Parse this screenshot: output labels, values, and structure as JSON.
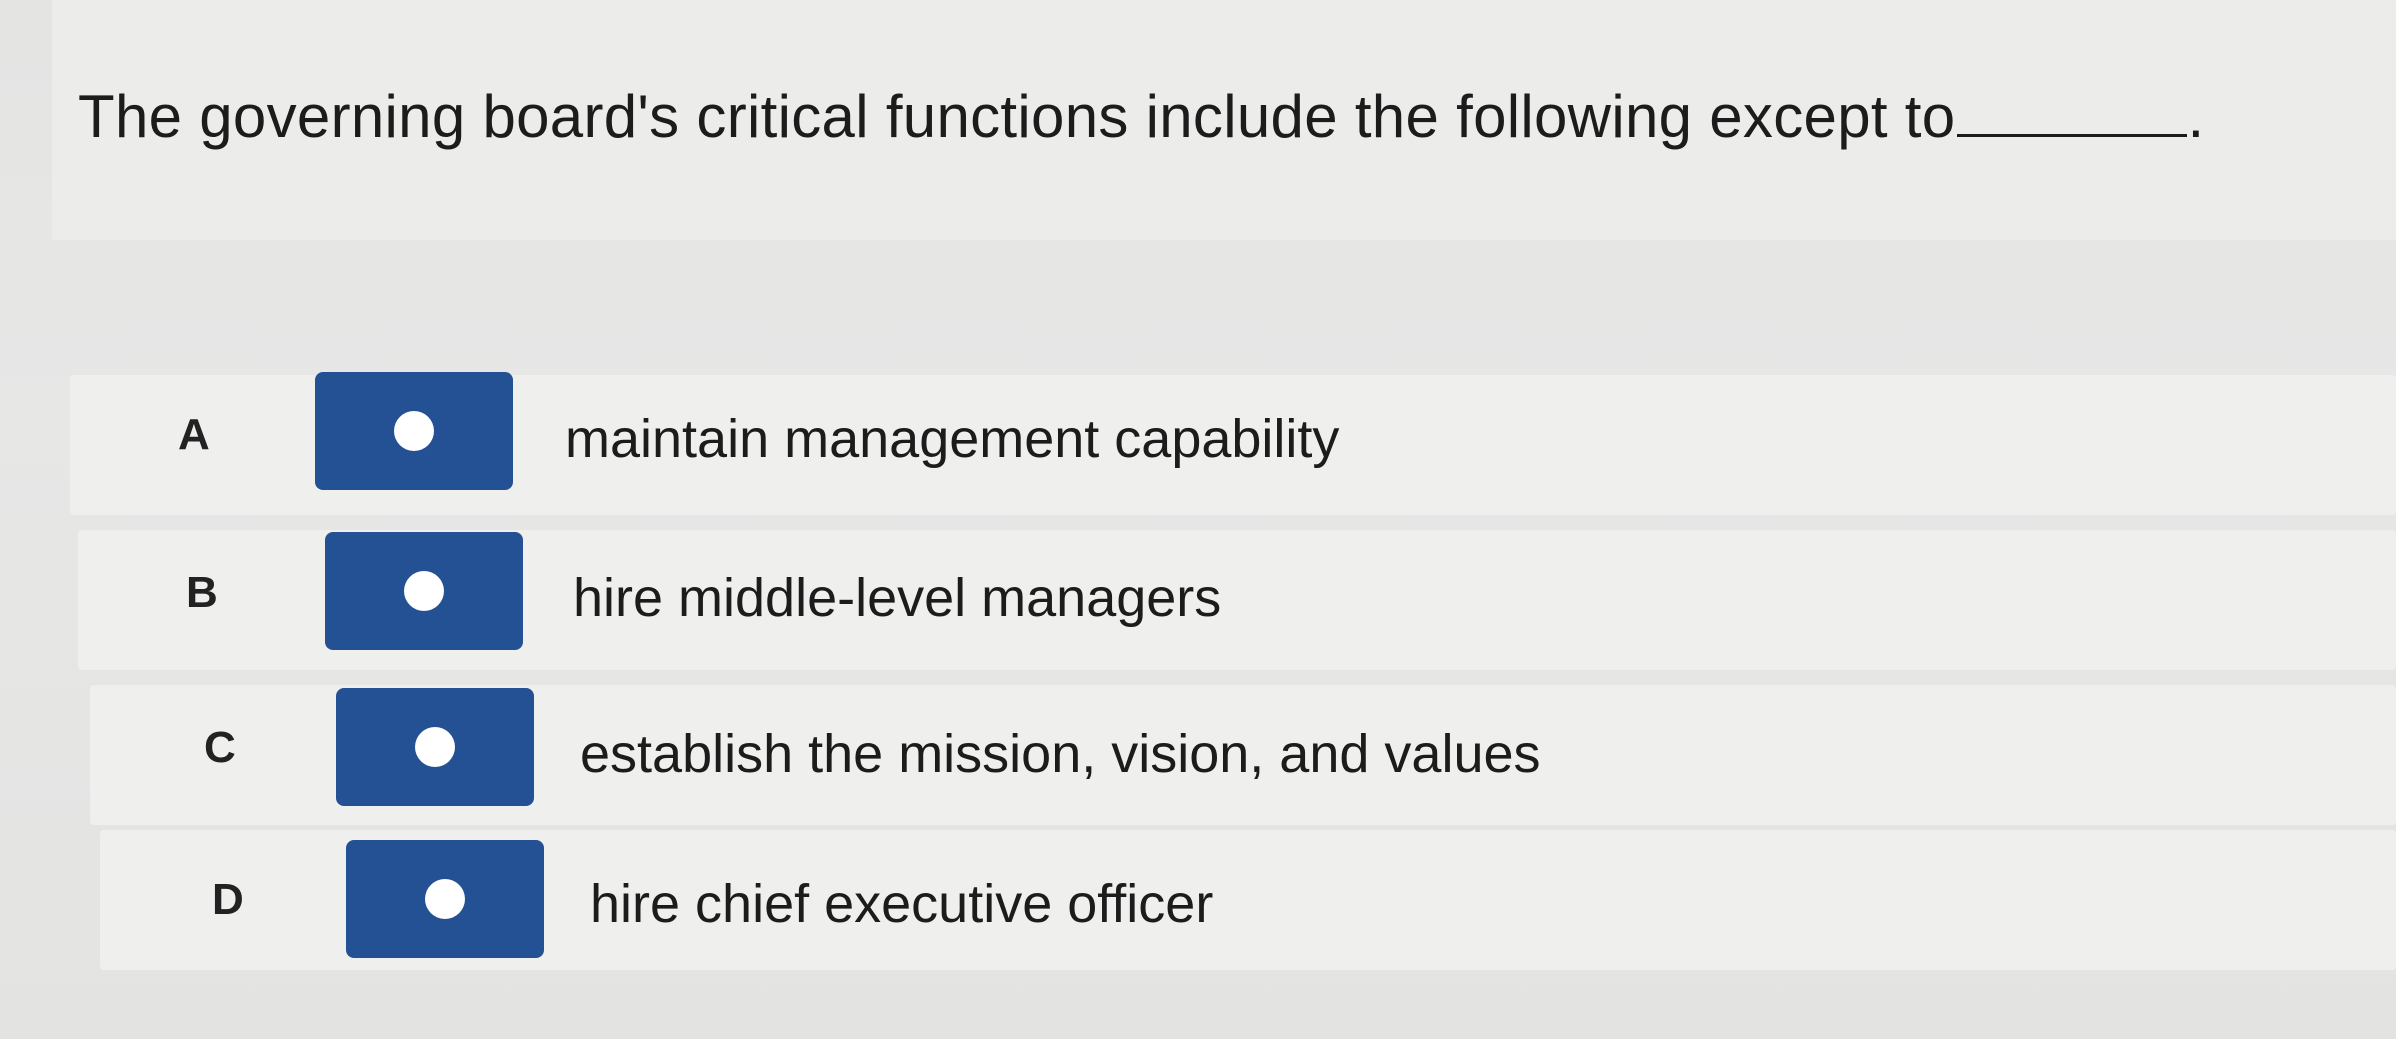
{
  "question": {
    "text": "The governing board's critical functions include the following except to",
    "trailing_punctuation": "."
  },
  "options": [
    {
      "letter": "A",
      "text": "maintain management capability",
      "selected": false
    },
    {
      "letter": "B",
      "text": "hire middle-level managers",
      "selected": false
    },
    {
      "letter": "C",
      "text": "establish the mission, vision, and values",
      "selected": false
    },
    {
      "letter": "D",
      "text": "hire chief executive officer",
      "selected": false
    }
  ],
  "colors": {
    "radio_background": "#245193",
    "radio_dot": "#ffffff",
    "text": "#1c1c1c"
  }
}
